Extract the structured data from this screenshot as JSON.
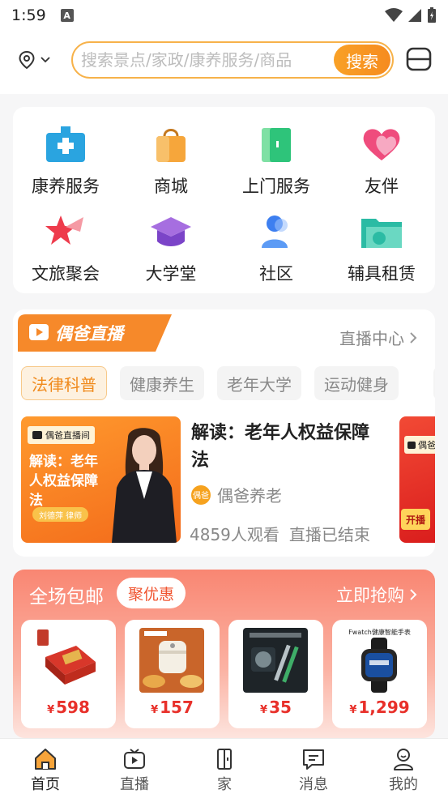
{
  "status": {
    "time": "1:59",
    "notification_glyph": "A"
  },
  "search": {
    "placeholder": "搜索景点/家政/康养服务/商品",
    "button": "搜索"
  },
  "services": [
    {
      "label": "康养服务",
      "icon": "health-care-icon"
    },
    {
      "label": "商城",
      "icon": "shopping-bag-icon"
    },
    {
      "label": "上门服务",
      "icon": "door-icon"
    },
    {
      "label": "友伴",
      "icon": "heart-icon"
    },
    {
      "label": "文旅聚会",
      "icon": "star-flag-icon"
    },
    {
      "label": "大学堂",
      "icon": "graduation-cap-icon"
    },
    {
      "label": "社区",
      "icon": "person-icon"
    },
    {
      "label": "辅具租赁",
      "icon": "folder-icon"
    }
  ],
  "live": {
    "banner": "偶爸直播",
    "center_link": "直播中心",
    "tabs": [
      "法律科普",
      "健康养生",
      "老年大学",
      "运动健身"
    ],
    "item": {
      "thumb_tag": "偶爸直播间",
      "thumb_text": "解读：老年人权益保障法",
      "thumb_name": "刘德萍 律师",
      "title": "解读：老年人权益保障法",
      "author_badge": "偶爸",
      "author": "偶爸养老",
      "views": "4859人观看",
      "status": "直播已结束"
    },
    "next_item": {
      "thumb_tag": "偶爸",
      "thumb_text": "开播"
    }
  },
  "promo": {
    "title": "全场包邮",
    "badge": "聚优惠",
    "link": "立即抢购",
    "currency": "¥",
    "products": [
      {
        "price": "598",
        "image": "gift-box"
      },
      {
        "price": "157",
        "image": "air-fryer"
      },
      {
        "price": "35",
        "image": "pen-set"
      },
      {
        "price": "1,299",
        "image": "smart-watch",
        "caption": "Fwatch健康智能手表"
      }
    ]
  },
  "nav": [
    {
      "label": "首页",
      "icon": "home-icon"
    },
    {
      "label": "直播",
      "icon": "tv-icon"
    },
    {
      "label": "家",
      "icon": "door-icon"
    },
    {
      "label": "消息",
      "icon": "message-icon"
    },
    {
      "label": "我的",
      "icon": "profile-icon"
    }
  ],
  "colors": {
    "accent": "#f68b1f",
    "promo": "#f98672",
    "price": "#e8302a"
  }
}
